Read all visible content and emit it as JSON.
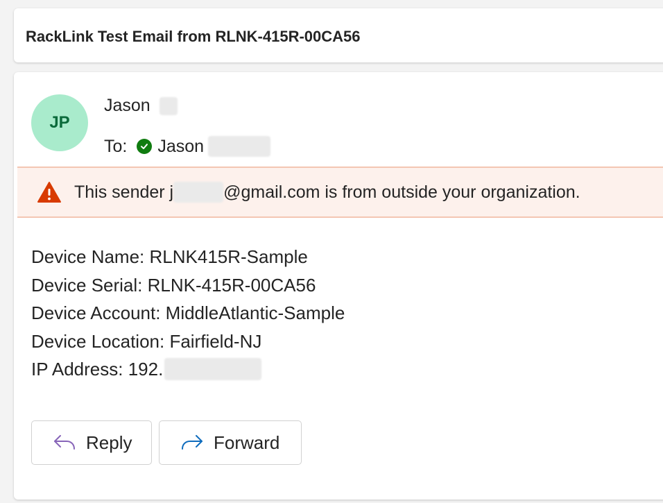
{
  "subject": "RackLink Test Email from RLNK-415R-00CA56",
  "sender": {
    "initials": "JP",
    "name": "Jason",
    "avatar_color": "#a9ebcc",
    "avatar_text_color": "#0b6a3b"
  },
  "recipient": {
    "to_label": "To:",
    "name": "Jason"
  },
  "warning": {
    "text_before": "This sender j",
    "text_after": "@gmail.com is from outside your organization.",
    "color": "#d13438",
    "background": "#fdf1ec"
  },
  "body": {
    "device_name": "Device Name: RLNK415R-Sample",
    "device_serial": "Device Serial: RLNK-415R-00CA56",
    "device_account": "Device Account: MiddleAtlantic-Sample",
    "device_location": "Device Location: Fairfield-NJ",
    "ip_address_prefix": "IP Address: 192."
  },
  "actions": {
    "reply_label": "Reply",
    "reply_icon": "reply-arrow-icon",
    "reply_icon_color": "#8764b8",
    "forward_label": "Forward",
    "forward_icon": "forward-arrow-icon",
    "forward_icon_color": "#0f6cbd"
  }
}
